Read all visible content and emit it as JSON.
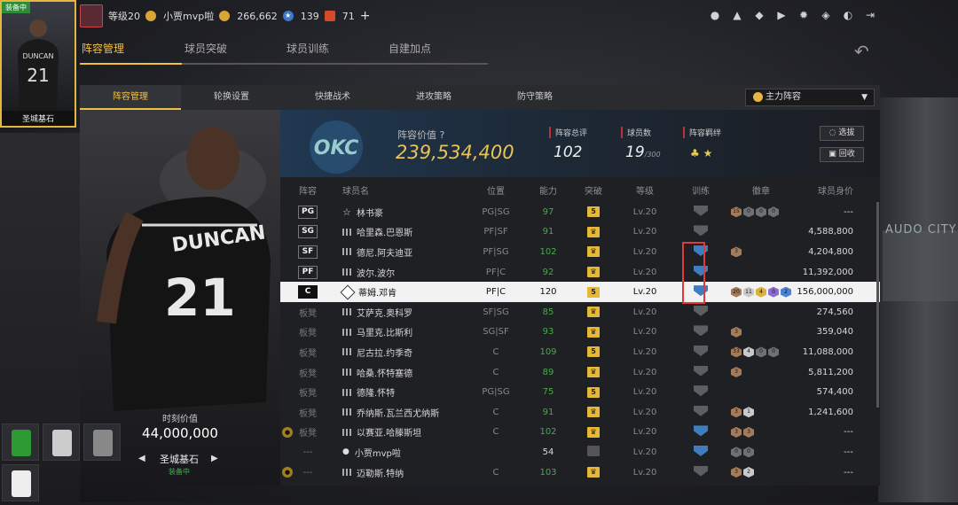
{
  "top_card": {
    "tag": "装备中",
    "name": "圣城基石"
  },
  "header": {
    "level": "等级20",
    "username": "小贾mvp啦",
    "coins": "266,662",
    "stars": "139",
    "tickets": "71",
    "plus": "+"
  },
  "header_icons": [
    "user-icon",
    "bell-icon",
    "friends-icon",
    "video-icon",
    "gear-icon",
    "shield-icon",
    "headset-icon",
    "exit-icon"
  ],
  "main_tabs": [
    "阵容管理",
    "球员突破",
    "球员训练",
    "自建加点"
  ],
  "sub_tabs": [
    "阵容管理",
    "轮换设置",
    "快捷战术",
    "进攻策略",
    "防守策略"
  ],
  "lineup_select": "主力阵容",
  "player_panel": {
    "value_label": "时刻价值",
    "value": "44,000,000",
    "name": "圣城基石",
    "status": "装备中"
  },
  "stats": {
    "lineup_value_label": "阵容价值",
    "lineup_value": "239,534,400",
    "rating_label": "阵容总评",
    "rating": "102",
    "count_label": "球员数",
    "count": "19",
    "count_max": "/300",
    "chem_label": "阵容羁绊",
    "select_btn": "选拔",
    "recycle_btn": "回收"
  },
  "table": {
    "headers": [
      "阵容",
      "球员名",
      "位置",
      "能力",
      "突破",
      "等级",
      "训练",
      "徽章",
      "球员身价"
    ],
    "rows": [
      {
        "slot": "PG",
        "name": "林书豪",
        "pos": "PG|SG",
        "ovr": "97",
        "brk": "5",
        "lv": "Lv.20",
        "val": "---",
        "icon": "star",
        "badges": [
          [
            "b-br",
            "15"
          ],
          [
            "b-gr",
            "0"
          ],
          [
            "b-gr",
            "0"
          ],
          [
            "b-gr",
            "0"
          ]
        ]
      },
      {
        "slot": "SG",
        "name": "哈里森.巴恩斯",
        "pos": "PF|SF",
        "ovr": "91",
        "brk": "c",
        "lv": "Lv.20",
        "val": "4,588,800",
        "icon": "sig",
        "badges": []
      },
      {
        "slot": "SF",
        "name": "德尼.阿夫迪亚",
        "pos": "PF|SG",
        "ovr": "102",
        "brk": "c",
        "lv": "Lv.20",
        "val": "4,204,800",
        "icon": "sig",
        "badges": [
          [
            "b-br",
            "3"
          ]
        ]
      },
      {
        "slot": "PF",
        "name": "波尔.波尔",
        "pos": "PF|C",
        "ovr": "92",
        "brk": "c",
        "lv": "Lv.20",
        "val": "11,392,000",
        "icon": "sig",
        "badges": []
      },
      {
        "slot": "C",
        "name": "蒂姆.邓肯",
        "pos": "PF|C",
        "ovr": "120",
        "brk": "5",
        "lv": "Lv.20",
        "val": "156,000,000",
        "icon": "dia",
        "badges": [
          [
            "b-br",
            "20"
          ],
          [
            "b-si",
            "11"
          ],
          [
            "b-go",
            "4"
          ],
          [
            "b-pu",
            "0"
          ],
          [
            "b-bl",
            "2"
          ]
        ]
      },
      {
        "slot": "板凳",
        "name": "艾萨克.奥科罗",
        "pos": "SF|SG",
        "ovr": "85",
        "brk": "c",
        "lv": "Lv.20",
        "val": "274,560",
        "icon": "sig",
        "badges": []
      },
      {
        "slot": "板凳",
        "name": "马里克.比斯利",
        "pos": "SG|SF",
        "ovr": "93",
        "brk": "c",
        "lv": "Lv.20",
        "val": "359,040",
        "icon": "sig",
        "badges": [
          [
            "b-br",
            "3"
          ]
        ]
      },
      {
        "slot": "板凳",
        "name": "尼古拉.约季奇",
        "pos": "C",
        "ovr": "109",
        "brk": "5",
        "lv": "Lv.20",
        "val": "11,088,000",
        "icon": "sig",
        "badges": [
          [
            "b-br",
            "33"
          ],
          [
            "b-si",
            "4"
          ],
          [
            "b-gr",
            "0"
          ],
          [
            "b-gr",
            "0"
          ]
        ]
      },
      {
        "slot": "板凳",
        "name": "哈桑.怀特塞德",
        "pos": "C",
        "ovr": "89",
        "brk": "c",
        "lv": "Lv.20",
        "val": "5,811,200",
        "icon": "sig",
        "badges": [
          [
            "b-br",
            "3"
          ]
        ]
      },
      {
        "slot": "板凳",
        "name": "德隆.怀特",
        "pos": "PG|SG",
        "ovr": "75",
        "brk": "5",
        "lv": "Lv.20",
        "val": "574,400",
        "icon": "sig",
        "badges": []
      },
      {
        "slot": "板凳",
        "name": "乔纳斯.瓦兰西尤纳斯",
        "pos": "C",
        "ovr": "91",
        "brk": "c",
        "lv": "Lv.20",
        "val": "1,241,600",
        "icon": "sig",
        "badges": [
          [
            "b-br",
            "3"
          ],
          [
            "b-si",
            "1"
          ]
        ]
      },
      {
        "slot": "板凳",
        "name": "以赛亚.哈滕斯坦",
        "pos": "C",
        "ovr": "102",
        "brk": "c",
        "lv": "Lv.20",
        "val": "---",
        "icon": "sig",
        "badges": [
          [
            "b-br",
            "3"
          ],
          [
            "b-br",
            "3"
          ]
        ]
      },
      {
        "slot": "---",
        "name": "小贾mvp啦",
        "pos": "",
        "ovr": "54",
        "brk": "g",
        "lv": "Lv.20",
        "val": "---",
        "icon": "usr",
        "badges": [
          [
            "b-gr",
            "0"
          ],
          [
            "b-gr",
            "0"
          ]
        ]
      },
      {
        "slot": "---",
        "name": "迈勒斯.特纳",
        "pos": "C",
        "ovr": "103",
        "brk": "c",
        "lv": "Lv.20",
        "val": "---",
        "icon": "sig",
        "badges": [
          [
            "b-br",
            "3"
          ],
          [
            "b-si",
            "2"
          ]
        ]
      }
    ]
  },
  "colors": {
    "accent": "#f0c040",
    "ability_green": "#4aa84a",
    "select_red": "#e03a3a"
  }
}
